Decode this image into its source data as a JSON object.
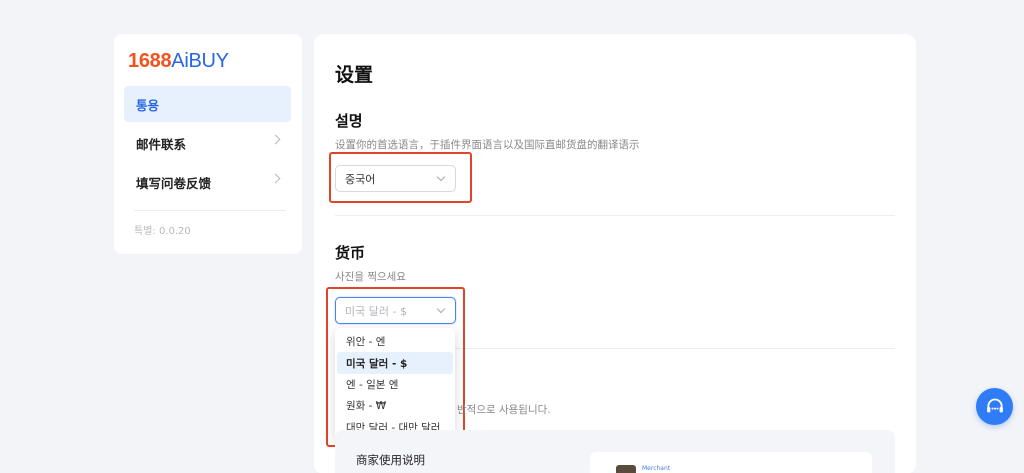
{
  "sidebar": {
    "logo_num": "1688",
    "logo_brand": "AiBUY",
    "items": [
      {
        "label": "통용"
      },
      {
        "label": "邮件联系"
      },
      {
        "label": "填写问卷反馈"
      }
    ],
    "version": "특별: 0.0.20"
  },
  "main": {
    "title": "设置",
    "language": {
      "title": "설명",
      "desc": "设置你的首选语言，于插件界面语言以及国际直邮货盘的翻译语示",
      "selected": "중국어"
    },
    "currency": {
      "title": "货币",
      "desc": "사진을 찍으세요",
      "selected": "미국 달러 - $",
      "options": [
        "위안 - 엔",
        "미국 달러 - $",
        "엔 - 일본 엔",
        "원화 - ₩",
        "대만 달러 - 대만 달러"
      ]
    },
    "hint": "반적으로 사용됩니다.",
    "merchant_title": "商家使用说明",
    "preview_label": "Merchant"
  },
  "colors": {
    "accent": "#2766e6",
    "highlight": "#e0452b",
    "logo_orange": "#f0541e"
  }
}
